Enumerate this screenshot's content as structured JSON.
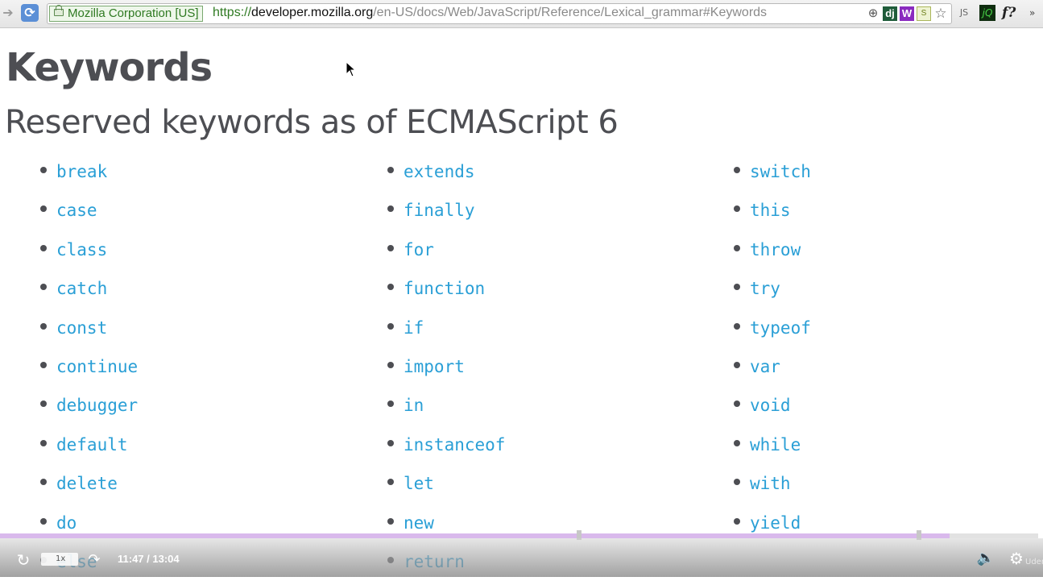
{
  "browser": {
    "ev_label": "Mozilla Corporation [US]",
    "url_scheme": "https://",
    "url_host": "developer.mozilla.org",
    "url_path": "/en-US/docs/Web/JavaScript/Reference/Lexical_grammar#Keywords",
    "ext_dj": "dj",
    "ext_w": "W",
    "ext_s": "S",
    "ext_js": "JS",
    "ext_jq": "jQ",
    "ext_f": "f?",
    "ext_more": "»"
  },
  "page": {
    "title": "Keywords",
    "subtitle": "Reserved keywords as of ECMAScript 6"
  },
  "keywords": {
    "col1": [
      "break",
      "case",
      "class",
      "catch",
      "const",
      "continue",
      "debugger",
      "default",
      "delete",
      "do",
      "else"
    ],
    "col2": [
      "extends",
      "finally",
      "for",
      "function",
      "if",
      "import",
      "in",
      "instanceof",
      "let",
      "new",
      "return"
    ],
    "col3": [
      "switch",
      "this",
      "throw",
      "try",
      "typeof",
      "var",
      "void",
      "while",
      "with",
      "yield"
    ]
  },
  "player": {
    "time": "11:47 / 13:04",
    "speed": "1x",
    "progress": 0.915,
    "logo": "Udemy",
    "progress_color": "#d9b9ec"
  },
  "colors": {
    "link": "#2a9fd6",
    "heading": "#4d4e53"
  }
}
